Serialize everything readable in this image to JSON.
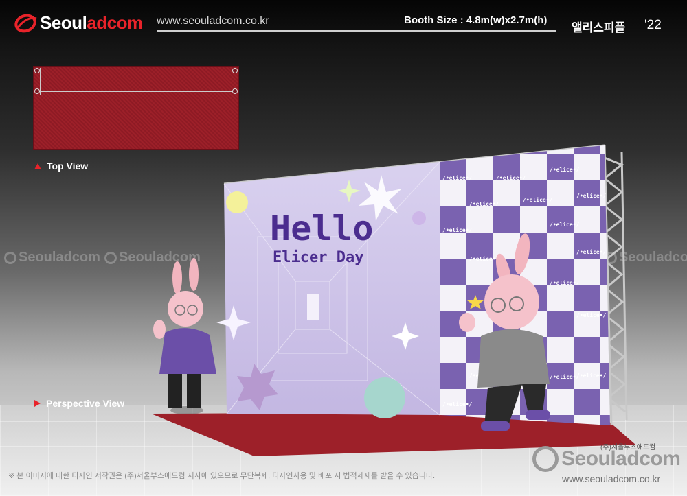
{
  "header": {
    "logo_part1": "Seoul",
    "logo_part2": "adcom",
    "site_url": "www.seouladcom.co.kr",
    "booth_size": "Booth Size : 4.8m(w)x2.7m(h)",
    "event_name": "앨리스피플",
    "year": "'22"
  },
  "views": {
    "top_label": "Top View",
    "perspective_label": "Perspective View"
  },
  "backwall": {
    "headline": "Hello",
    "subheadline": "Elicer Day",
    "logo_tile_text": "/•elice•/"
  },
  "watermark": {
    "text": "Seouladcom"
  },
  "footer": {
    "copyright_note": "※ 본 이미지에 대한 디자인 저작권은 (주)서울부스애드컴 지사에 있으므로 무단복제, 디자인사용 및 배포 시 법적제재를 받을 수 있습니다.",
    "company_name": "(주)서울부스애드컴",
    "logo_text": "Seouladcom",
    "url": "www.seouladcom.co.kr"
  },
  "colors": {
    "accent_red": "#e8232a",
    "carpet_red": "#9d2029",
    "wall_lavender": "#c9bde6",
    "checker_purple": "#7a62b0",
    "headline_purple": "#4b2d8f"
  }
}
